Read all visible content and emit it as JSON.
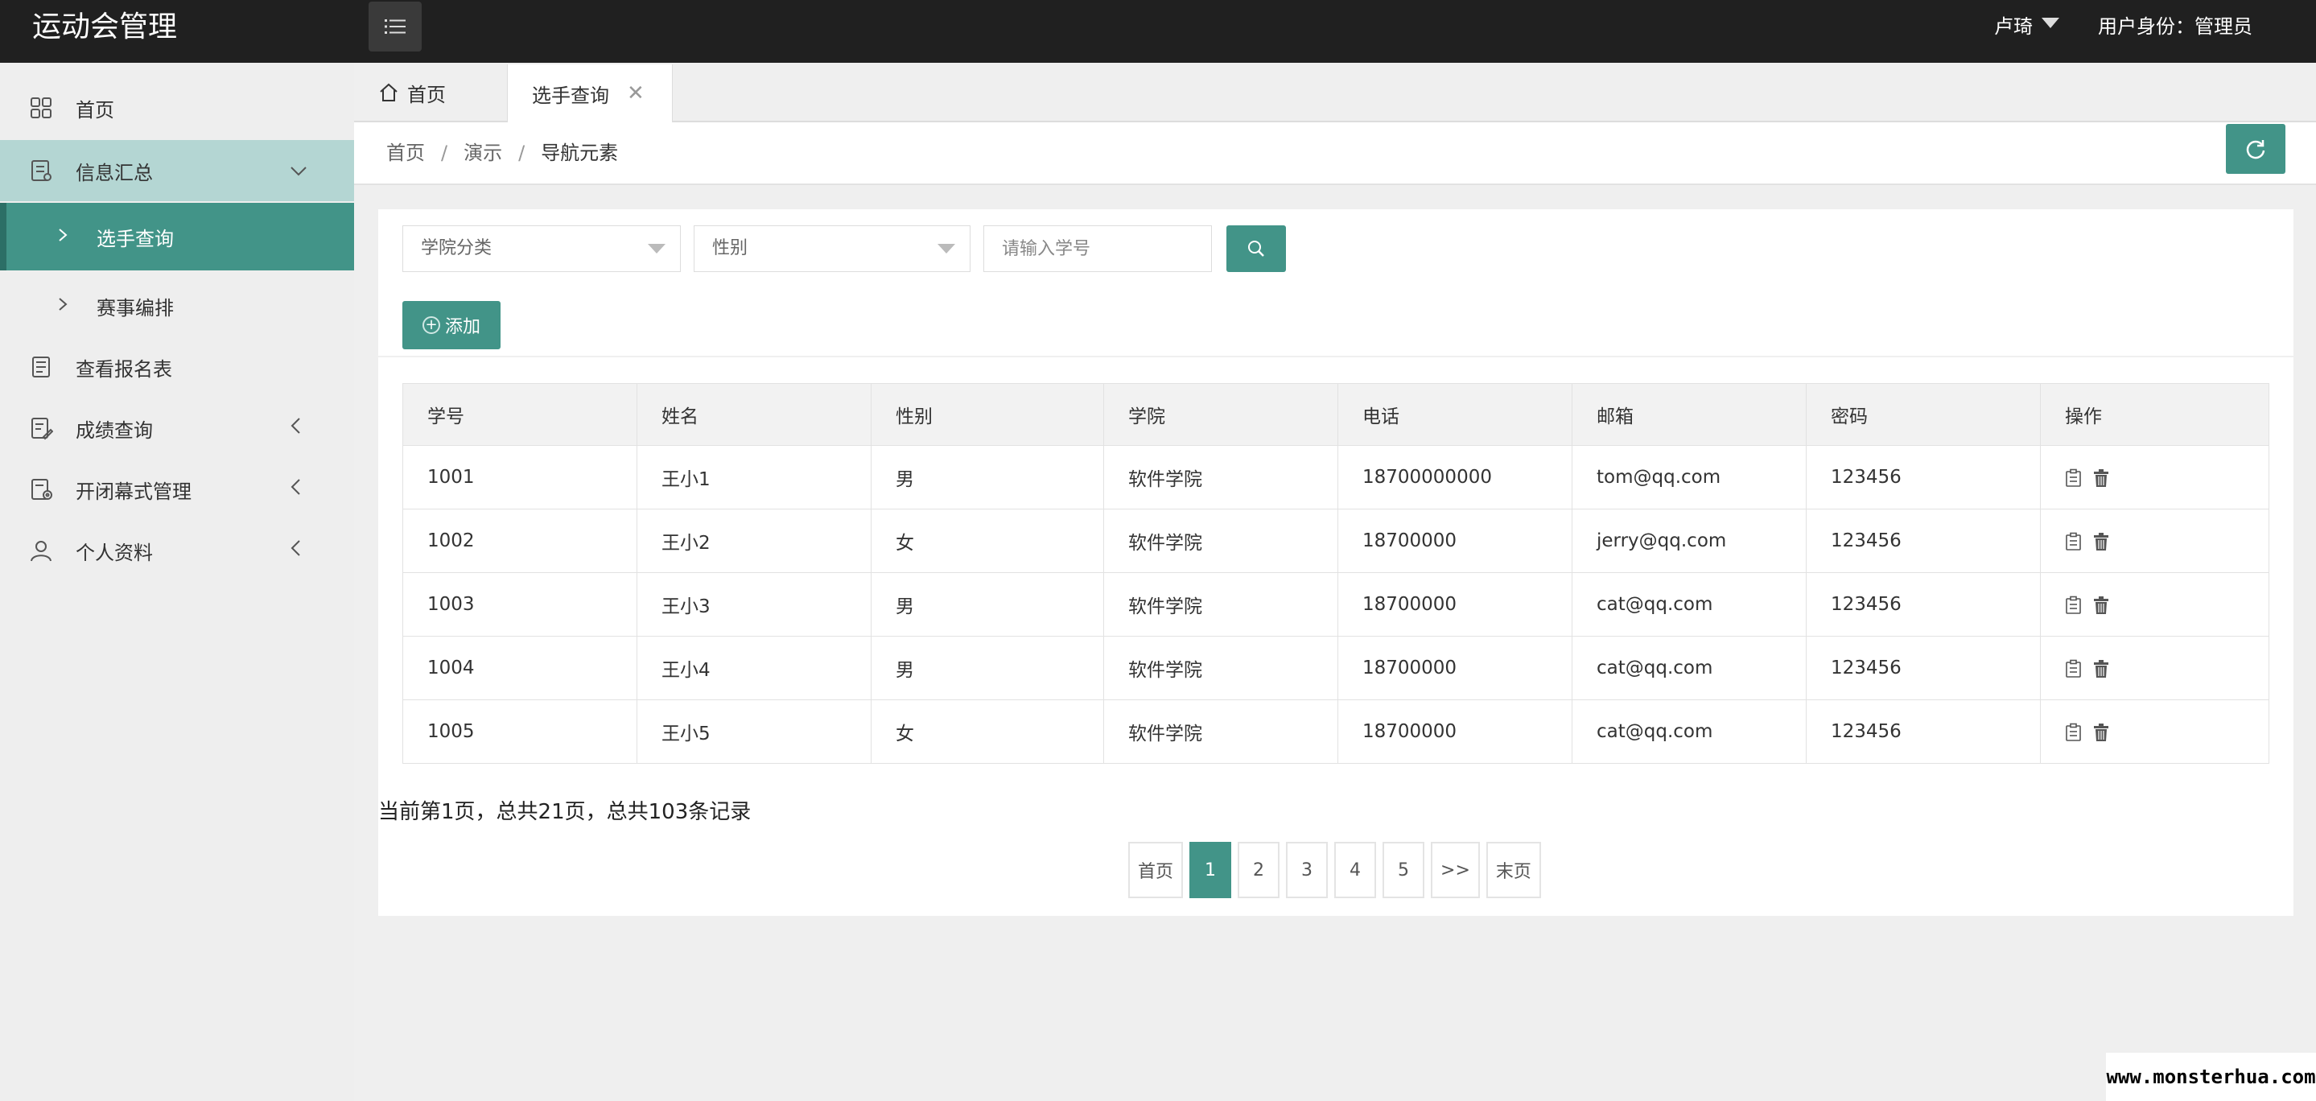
{
  "header": {
    "title": "运动会管理",
    "menu_icon": "list-icon",
    "user_name": "卢琦",
    "user_role": "用户身份：管理员"
  },
  "sidebar": {
    "items": [
      {
        "label": "首页",
        "icon": "grid-icon"
      },
      {
        "label": "信息汇总",
        "icon": "document-icon",
        "expanded": true
      },
      {
        "label": "选手查询",
        "sub": true,
        "active": true
      },
      {
        "label": "赛事编排",
        "sub": true
      },
      {
        "label": "查看报名表",
        "icon": "list-doc-icon"
      },
      {
        "label": "成绩查询",
        "icon": "edit-doc-icon"
      },
      {
        "label": "开闭幕式管理",
        "icon": "settings-doc-icon"
      },
      {
        "label": "个人资料",
        "icon": "user-icon"
      }
    ]
  },
  "tabs": {
    "home": "首页",
    "current": "选手查询"
  },
  "breadcrumb": {
    "items": [
      "首页",
      "演示",
      "导航元素"
    ],
    "separator": "/"
  },
  "filters": {
    "college_placeholder": "学院分类",
    "gender_placeholder": "性别",
    "student_id_placeholder": "请输入学号",
    "add_label": "添加"
  },
  "table": {
    "headers": [
      "学号",
      "姓名",
      "性别",
      "学院",
      "电话",
      "邮箱",
      "密码",
      "操作"
    ],
    "rows": [
      [
        "1001",
        "王小1",
        "男",
        "软件学院",
        "18700000000",
        "tom@qq.com",
        "123456"
      ],
      [
        "1002",
        "王小2",
        "女",
        "软件学院",
        "18700000",
        "jerry@qq.com",
        "123456"
      ],
      [
        "1003",
        "王小3",
        "男",
        "软件学院",
        "18700000",
        "cat@qq.com",
        "123456"
      ],
      [
        "1004",
        "王小4",
        "男",
        "软件学院",
        "18700000",
        "cat@qq.com",
        "123456"
      ],
      [
        "1005",
        "王小5",
        "女",
        "软件学院",
        "18700000",
        "cat@qq.com",
        "123456"
      ]
    ]
  },
  "pagination": {
    "info": "当前第1页，总共21页，总共103条记录",
    "first": "首页",
    "pages": [
      "1",
      "2",
      "3",
      "4",
      "5"
    ],
    "current": "1",
    "next": ">>",
    "last": "末页"
  },
  "watermark": "www.monsterhua.com",
  "colors": {
    "accent": "#429488",
    "accent_light": "#b4d6d3",
    "header_bg": "#202020"
  }
}
